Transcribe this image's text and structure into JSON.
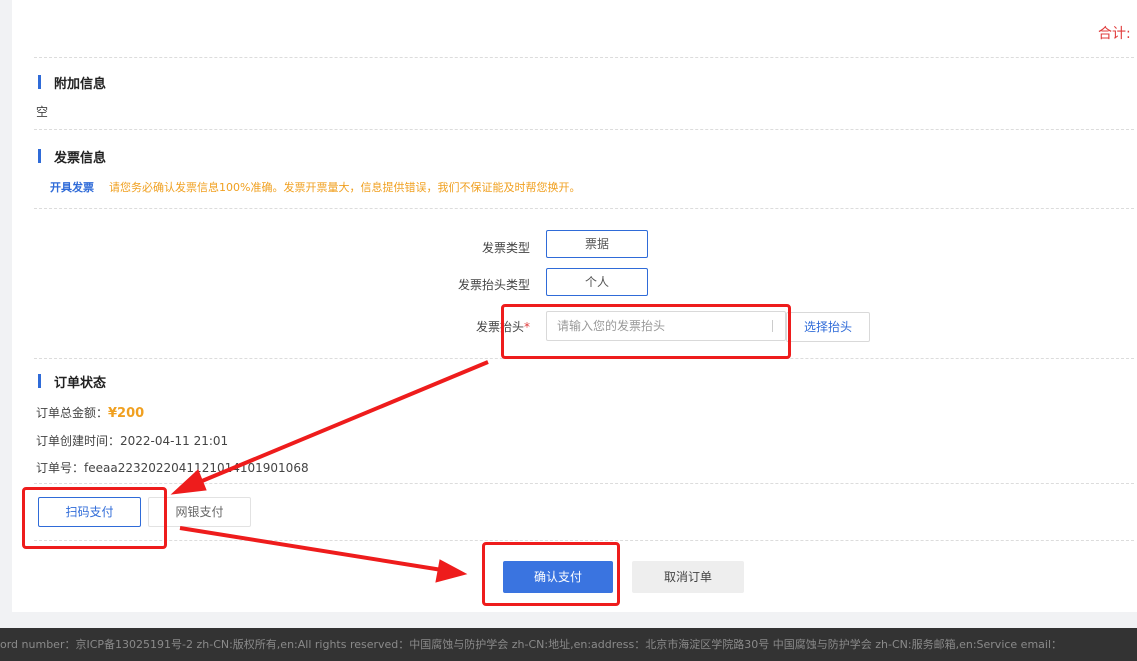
{
  "summary": {
    "total_label": "合计:"
  },
  "extra_info": {
    "title": "附加信息",
    "content": "空"
  },
  "invoice": {
    "title": "发票信息",
    "toggle_label": "开具发票",
    "warning": "请您务必确认发票信息100%准确。发票开票量大，信息提供错误，我们不保证能及时帮您换开。",
    "type_label": "发票类型",
    "type_value": "票据",
    "header_type_label": "发票抬头类型",
    "header_type_value": "个人",
    "header_label": "发票抬头",
    "required_mark": "*",
    "header_placeholder": "请输入您的发票抬头",
    "select_header_button": "选择抬头"
  },
  "order": {
    "title": "订单状态",
    "amount_label": "订单总金额：",
    "amount_value": "¥200",
    "created_label": "订单创建时间：",
    "created_value": "2022-04-11 21:01",
    "number_label": "订单号：",
    "number_value": "feeaa2232022041121014101901068"
  },
  "payment": {
    "scan_pay": "扫码支付",
    "bank_pay": "网银支付",
    "confirm": "确认支付",
    "cancel": "取消订单"
  },
  "footer": {
    "text": "ord number：京ICP备13025191号-2 zh-CN:版权所有,en:All rights reserved：中国腐蚀与防护学会 zh-CN:地址,en:address：北京市海淀区学院路30号 中国腐蚀与防护学会 zh-CN:服务邮箱,en:Service email："
  },
  "colors": {
    "accent": "#2f6bd8",
    "warning": "#f0a020",
    "price": "#f0a020",
    "total": "#e03c3c",
    "annotation": "#ee1c1c"
  }
}
